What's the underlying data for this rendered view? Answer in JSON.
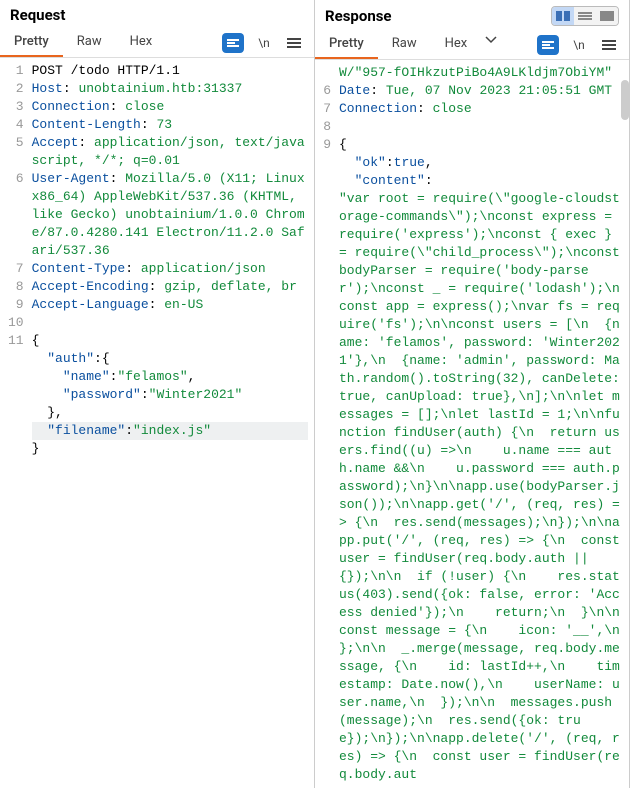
{
  "request": {
    "title": "Request",
    "tabs": [
      "Pretty",
      "Raw",
      "Hex"
    ],
    "activeTab": 0,
    "lines": [
      {
        "n": "1",
        "segs": [
          [
            "black",
            "POST /todo HTTP/1.1"
          ]
        ]
      },
      {
        "n": "2",
        "segs": [
          [
            "key",
            "Host"
          ],
          [
            "punc",
            ": "
          ],
          [
            "val",
            "unobtainium.htb:31337"
          ]
        ]
      },
      {
        "n": "3",
        "segs": [
          [
            "key",
            "Connection"
          ],
          [
            "punc",
            ": "
          ],
          [
            "val",
            "close"
          ]
        ]
      },
      {
        "n": "4",
        "segs": [
          [
            "key",
            "Content-Length"
          ],
          [
            "punc",
            ": "
          ],
          [
            "val",
            "73"
          ]
        ]
      },
      {
        "n": "5",
        "segs": [
          [
            "key",
            "Accept"
          ],
          [
            "punc",
            ": "
          ],
          [
            "val",
            "application/json, text/javascript, */*; q=0.01"
          ]
        ]
      },
      {
        "n": "6",
        "segs": [
          [
            "key",
            "User-Agent"
          ],
          [
            "punc",
            ": "
          ],
          [
            "val",
            "Mozilla/5.0 (X11; Linux x86_64) AppleWebKit/537.36 (KHTML, like Gecko) unobtainium/1.0.0 Chrome/87.0.4280.141 Electron/11.2.0 Safari/537.36"
          ]
        ]
      },
      {
        "n": "7",
        "segs": [
          [
            "key",
            "Content-Type"
          ],
          [
            "punc",
            ": "
          ],
          [
            "val",
            "application/json"
          ]
        ]
      },
      {
        "n": "8",
        "segs": [
          [
            "key",
            "Accept-Encoding"
          ],
          [
            "punc",
            ": "
          ],
          [
            "val",
            "gzip, deflate, br"
          ]
        ]
      },
      {
        "n": "9",
        "segs": [
          [
            "key",
            "Accept-Language"
          ],
          [
            "punc",
            ": "
          ],
          [
            "val",
            "en-US"
          ]
        ]
      },
      {
        "n": "10",
        "segs": []
      },
      {
        "n": "11",
        "segs": [
          [
            "punc",
            "{"
          ]
        ]
      },
      {
        "n": "",
        "segs": [
          [
            "punc",
            "  "
          ],
          [
            "prop",
            "\"auth\""
          ],
          [
            "punc",
            ":{"
          ]
        ]
      },
      {
        "n": "",
        "segs": [
          [
            "punc",
            "    "
          ],
          [
            "prop",
            "\"name\""
          ],
          [
            "punc",
            ":"
          ],
          [
            "str",
            "\"felamos\""
          ],
          [
            "punc",
            ","
          ]
        ]
      },
      {
        "n": "",
        "segs": [
          [
            "punc",
            "    "
          ],
          [
            "prop",
            "\"password\""
          ],
          [
            "punc",
            ":"
          ],
          [
            "str",
            "\"Winter2021\""
          ]
        ]
      },
      {
        "n": "",
        "segs": [
          [
            "punc",
            "  },"
          ]
        ]
      },
      {
        "n": "",
        "hl": true,
        "segs": [
          [
            "punc",
            "  "
          ],
          [
            "prop",
            "\"filename\""
          ],
          [
            "punc",
            ":"
          ],
          [
            "str",
            "\"index.js\""
          ]
        ]
      },
      {
        "n": "",
        "segs": [
          [
            "punc",
            "}"
          ]
        ]
      }
    ]
  },
  "response": {
    "title": "Response",
    "tabs": [
      "Pretty",
      "Raw",
      "Hex"
    ],
    "activeTab": 0,
    "lines": [
      {
        "n": "",
        "segs": [
          [
            "val",
            "W/\"957-fOIHkzutPiBo4A9LKldjm7ObiYM\""
          ]
        ]
      },
      {
        "n": "6",
        "segs": [
          [
            "key",
            "Date"
          ],
          [
            "punc",
            ": "
          ],
          [
            "val",
            "Tue, 07 Nov 2023 21:05:51 GMT"
          ]
        ]
      },
      {
        "n": "7",
        "segs": [
          [
            "key",
            "Connection"
          ],
          [
            "punc",
            ": "
          ],
          [
            "val",
            "close"
          ]
        ]
      },
      {
        "n": "8",
        "segs": []
      },
      {
        "n": "9",
        "segs": [
          [
            "punc",
            "{"
          ]
        ]
      },
      {
        "n": "",
        "segs": [
          [
            "punc",
            "  "
          ],
          [
            "prop",
            "\"ok\""
          ],
          [
            "punc",
            ":"
          ],
          [
            "keyword",
            "true"
          ],
          [
            "punc",
            ","
          ]
        ]
      },
      {
        "n": "",
        "segs": [
          [
            "punc",
            "  "
          ],
          [
            "prop",
            "\"content\""
          ],
          [
            "punc",
            ":"
          ]
        ]
      },
      {
        "n": "",
        "segs": [
          [
            "str",
            "\"var root = require(\\\"google-cloudstorage-commands\\\");\\nconst express = require('express');\\nconst { exec } = require(\\\"child_process\\\");\\nconst bodyParser = require('body-parser');\\nconst _ = require('lodash');\\nconst app = express();\\nvar fs = require('fs');\\n\\nconst users = [\\n  {name: 'felamos', password: 'Winter2021'},\\n  {name: 'admin', password: Math.random().toString(32), canDelete: true, canUpload: true},\\n];\\n\\nlet messages = [];\\nlet lastId = 1;\\n\\nfunction findUser(auth) {\\n  return users.find((u) =>\\n    u.name === auth.name &&\\n    u.password === auth.password);\\n}\\n\\napp.use(bodyParser.json());\\n\\napp.get('/', (req, res) => {\\n  res.send(messages);\\n});\\n\\napp.put('/', (req, res) => {\\n  const user = findUser(req.body.auth || {});\\n\\n  if (!user) {\\n    res.status(403).send({ok: false, error: 'Access denied'});\\n    return;\\n  }\\n\\n  const message = {\\n    icon: '__',\\n  };\\n\\n  _.merge(message, req.body.message, {\\n    id: lastId++,\\n    timestamp: Date.now(),\\n    userName: user.name,\\n  });\\n\\n  messages.push(message);\\n  res.send({ok: true});\\n});\\n\\napp.delete('/', (req, res) => {\\n  const user = findUser(req.body.aut"
          ]
        ]
      }
    ]
  }
}
